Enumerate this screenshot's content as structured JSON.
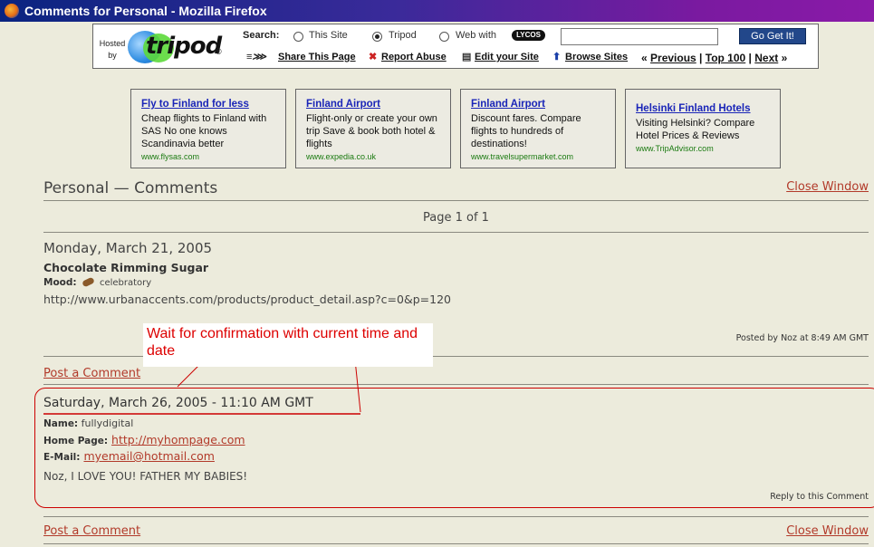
{
  "window": {
    "title": "Comments for Personal - Mozilla Firefox"
  },
  "tripod_bar": {
    "hosted_by_line1": "Hosted",
    "hosted_by_line2": "by",
    "logo_text": "tripod",
    "logo_mark": "®",
    "search_label": "Search:",
    "options": [
      "This Site",
      "Tripod",
      "Web with"
    ],
    "selected_option": "Tripod",
    "lycos_label": "LYCOS",
    "search_value": "",
    "go_label": "Go Get It!",
    "links": [
      "Share This Page",
      "Report Abuse",
      "Edit your Site",
      "Browse Sites"
    ],
    "nav_previous": "Previous",
    "nav_top100": "Top 100",
    "nav_next": "Next"
  },
  "ads": [
    {
      "title": "Fly to Finland for less",
      "body": "Cheap flights to Finland with SAS No one knows Scandinavia better",
      "url": "www.flysas.com"
    },
    {
      "title": "Finland Airport",
      "body": "Flight-only or create your own trip Save & book both hotel & flights",
      "url": "www.expedia.co.uk"
    },
    {
      "title": "Finland Airport",
      "body": "Discount fares. Compare flights to hundreds of destinations!",
      "url": "www.travelsupermarket.com"
    },
    {
      "title": "Helsinki Finland Hotels",
      "body": "Visiting Helsinki? Compare Hotel Prices & Reviews",
      "url": "www.TripAdvisor.com"
    }
  ],
  "page": {
    "heading": "Personal — Comments",
    "close_window": "Close Window",
    "pagination": "Page 1 of 1"
  },
  "post": {
    "date": "Monday, March 21, 2005",
    "title": "Chocolate Rimming Sugar",
    "mood_label": "Mood:",
    "mood_value": "celebratory",
    "body": "http://www.urbanaccents.com/products/product_detail.asp?c=0&p=120",
    "posted_by": "Posted by Noz at 8:49 AM GMT",
    "post_comment": "Post a Comment"
  },
  "annotation": {
    "text": "Wait for confirmation with current time and date"
  },
  "comment": {
    "date": "Saturday, March 26, 2005 - 11:10 AM GMT",
    "name_label": "Name:",
    "name_value": "fullydigital",
    "homepage_label": "Home Page:",
    "homepage_value": "http://myhompage.com",
    "email_label": "E-Mail:",
    "email_value": "myemail@hotmail.com",
    "body": "Noz, I LOVE YOU! FATHER MY BABIES!",
    "reply": "Reply to this Comment"
  },
  "footer": {
    "post_comment": "Post a Comment",
    "close_window": "Close Window"
  }
}
